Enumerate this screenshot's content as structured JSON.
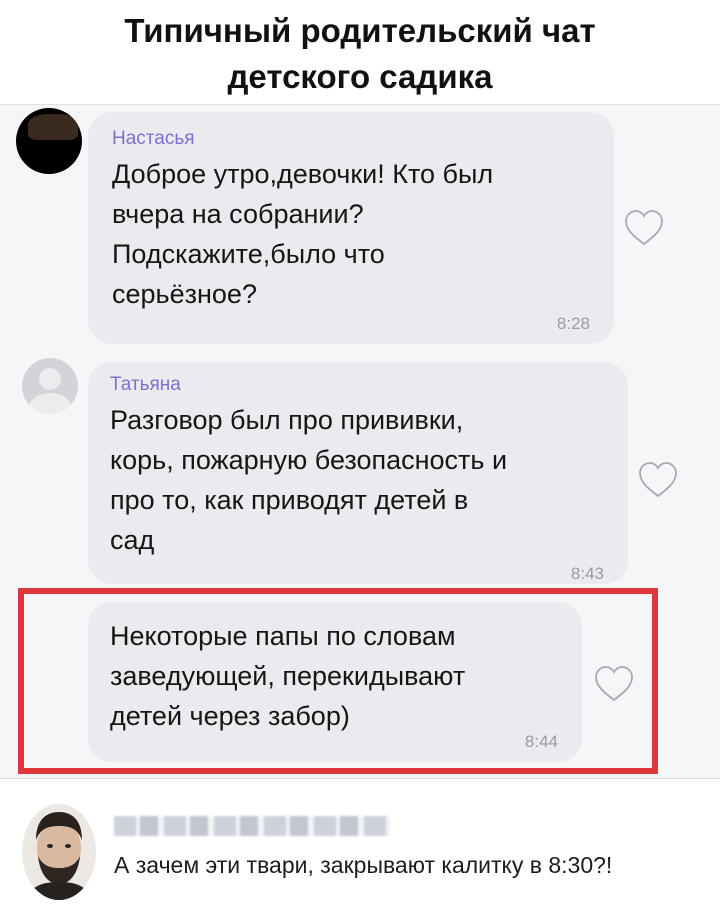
{
  "caption": {
    "line1": "Типичный родительский чат",
    "line2": "детского садика"
  },
  "messages": [
    {
      "author": "Настасья",
      "text": "Доброе утро,девочки! Кто был\nвчера на собрании?\nПодскажите,было что\nсерьёзное?",
      "time": "8:28",
      "avatar_icon": "dark-photo-avatar"
    },
    {
      "author": "Татьяна",
      "text": "Разговор был про прививки,\nкорь, пожарную безопасность и\nпро то, как приводят детей в\nсад",
      "time": "8:43",
      "avatar_icon": "default-user-avatar"
    },
    {
      "author": "",
      "text": "Некоторые папы по словам\nзаведующей, перекидывают\nдетей через забор)",
      "time": "8:44",
      "highlighted": true
    }
  ],
  "comment": {
    "text": "А зачем эти твари, закрывают калитку в 8:30?!",
    "name_blurred": true
  },
  "colors": {
    "author_name": "#7d6fcf",
    "bubble": "#ebebef",
    "highlight_border": "#e0373a",
    "chat_background": "#f6f6f8"
  }
}
